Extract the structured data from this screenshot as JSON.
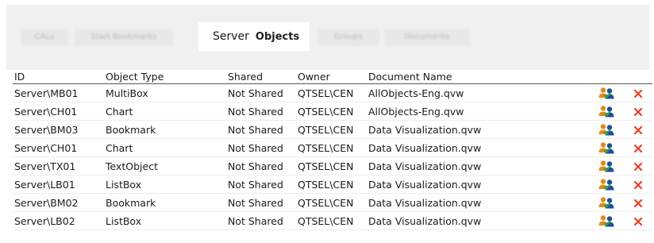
{
  "tabs": {
    "blurred": [
      "CALx",
      "Start Bookmarks",
      "Groups",
      "Documents"
    ],
    "active_server": "Server",
    "active_objects": "Objects"
  },
  "table": {
    "columns": [
      "ID",
      "Object Type",
      "Shared",
      "Owner",
      "Document Name"
    ],
    "rows": [
      {
        "id": "Server\\MB01",
        "type": "MultiBox",
        "shared": "Not Shared",
        "owner": "QTSEL\\CEN",
        "doc": "AllObjects-Eng.qvw"
      },
      {
        "id": "Server\\CH01",
        "type": "Chart",
        "shared": "Not Shared",
        "owner": "QTSEL\\CEN",
        "doc": "AllObjects-Eng.qvw"
      },
      {
        "id": "Server\\BM03",
        "type": "Bookmark",
        "shared": "Not Shared",
        "owner": "QTSEL\\CEN",
        "doc": "Data Visualization.qvw"
      },
      {
        "id": "Server\\CH01",
        "type": "Chart",
        "shared": "Not Shared",
        "owner": "QTSEL\\CEN",
        "doc": "Data Visualization.qvw"
      },
      {
        "id": "Server\\TX01",
        "type": "TextObject",
        "shared": "Not Shared",
        "owner": "QTSEL\\CEN",
        "doc": "Data Visualization.qvw"
      },
      {
        "id": "Server\\LB01",
        "type": "ListBox",
        "shared": "Not Shared",
        "owner": "QTSEL\\CEN",
        "doc": "Data Visualization.qvw"
      },
      {
        "id": "Server\\BM02",
        "type": "Bookmark",
        "shared": "Not Shared",
        "owner": "QTSEL\\CEN",
        "doc": "Data Visualization.qvw"
      },
      {
        "id": "Server\\LB02",
        "type": "ListBox",
        "shared": "Not Shared",
        "owner": "QTSEL\\CEN",
        "doc": "Data Visualization.qvw"
      }
    ],
    "row_icons": {
      "manage": "users-icon",
      "remove": "delete-icon"
    }
  },
  "colors": {
    "delete": "#e8402a",
    "user_orange": "#e08a1e",
    "user_blue": "#1e4f9c"
  }
}
